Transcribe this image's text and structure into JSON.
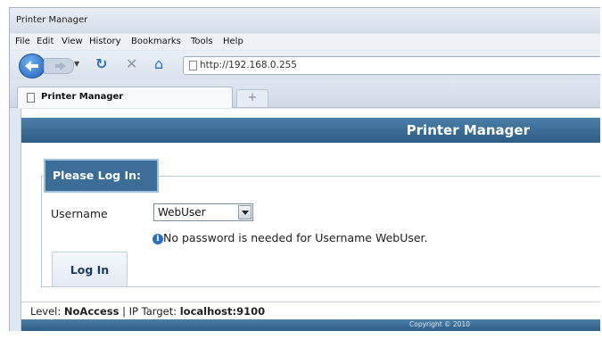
{
  "window": {
    "title": "Printer Manager"
  },
  "menu": [
    "File",
    "Edit",
    "View",
    "History",
    "Bookmarks",
    "Tools",
    "Help"
  ],
  "nav": {
    "url": "http://192.168.0.255"
  },
  "tabs": [
    {
      "label": "Printer Manager"
    }
  ],
  "new_tab_label": "+",
  "page": {
    "header_title": "Printer Manager",
    "login_legend": "Please Log In:",
    "username_label": "Username",
    "username_value": "WebUser",
    "info_icon_glyph": "i",
    "info_text": "No password is needed for Username WebUser.",
    "login_button": "Log In",
    "status": {
      "level_label": "Level:",
      "level_value": "NoAccess",
      "separator": "|",
      "target_label": "IP Target:",
      "target_value": "localhost:9100"
    },
    "copyright": "Copyright © 2010"
  },
  "icons": [
    "back-icon",
    "forward-icon",
    "reload-icon",
    "stop-icon",
    "home-icon",
    "page-icon",
    "info-icon",
    "dropdown-arrow-icon"
  ]
}
